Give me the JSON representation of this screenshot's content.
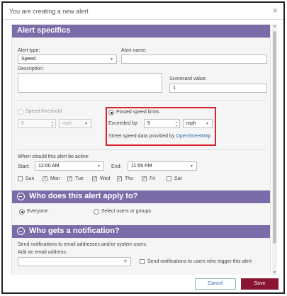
{
  "dialog": {
    "title": "You are creating a new alert",
    "close_glyph": "×"
  },
  "alert_specifics": {
    "heading": "Alert specifics",
    "alert_type_label": "Alert type:",
    "alert_type_value": "Speed",
    "alert_name_label": "Alert name:",
    "alert_name_value": "",
    "description_label": "Description:",
    "scorecard_label": "Scorecard value:",
    "scorecard_value": "1",
    "speed_threshold_label": "Speed threshold",
    "speed_threshold_value": "5",
    "speed_threshold_unit": "mph",
    "posted_limits_label": "Posted speed limits",
    "exceeded_by_label": "Exceeded by:",
    "exceeded_by_value": "5",
    "exceeded_by_unit": "mph",
    "street_data_text": "Street speed data provided by",
    "street_data_link": "OpenStreetMap",
    "active_label": "When should this alert be active:",
    "start_label": "Start:",
    "start_value": "12:00 AM",
    "end_label": "End:",
    "end_value": "11:59 PM",
    "days": [
      {
        "label": "Sun",
        "checked": false
      },
      {
        "label": "Mon",
        "checked": true
      },
      {
        "label": "Tue",
        "checked": true
      },
      {
        "label": "Wed",
        "checked": true
      },
      {
        "label": "Thu",
        "checked": true
      },
      {
        "label": "Fri",
        "checked": true
      },
      {
        "label": "Sat",
        "checked": false
      }
    ]
  },
  "applies_to": {
    "heading": "Who does this alert apply to?",
    "option_everyone": "Everyone",
    "option_select": "Select users or groups"
  },
  "notification": {
    "heading": "Who gets a notification?",
    "send_text": "Send notifications to email addresses and/or system users.",
    "email_label": "Add an email address:",
    "email_value": "",
    "add_glyph": "+",
    "notify_driver_label": "Send notifications to users who trigger this alert"
  },
  "footer": {
    "cancel_label": "Cancel",
    "save_label": "Save"
  },
  "colors": {
    "section_bar": "#7b6ba8",
    "save_button": "#8a1532",
    "highlight_border": "#d7232f",
    "link": "#2a6db5"
  }
}
